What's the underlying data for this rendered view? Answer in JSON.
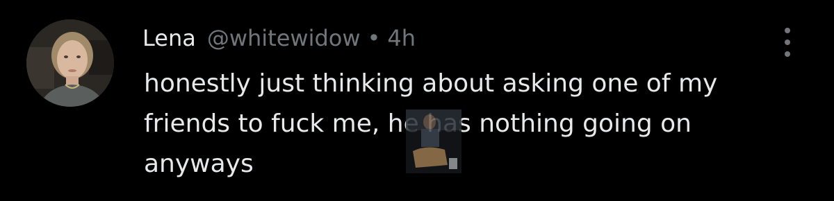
{
  "post": {
    "author": {
      "display_name": "Lena",
      "handle": "@whitewidow"
    },
    "separator": "•",
    "time": "4h",
    "text": "honestly just thinking about asking one of my\nfriends to fuck me, he has nothing going on\nanyways"
  },
  "icons": {
    "more": "more-vertical-icon",
    "avatar": "avatar-photo",
    "overlay": "embedded-photo"
  },
  "colors": {
    "background": "#000000",
    "primary_text": "#e7e9ea",
    "secondary_text": "#71767b"
  }
}
